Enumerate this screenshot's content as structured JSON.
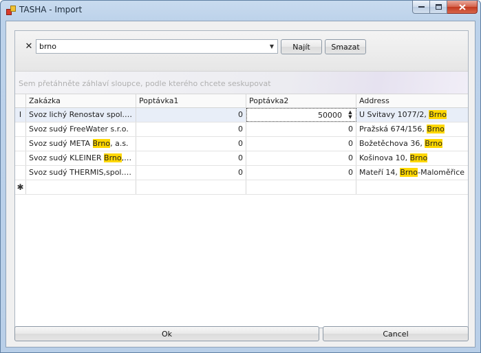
{
  "window": {
    "title": "TASHA - Import",
    "controls": {
      "minimize_icon": "minimize-icon",
      "maximize_icon": "maximize-icon",
      "close_icon": "close-icon"
    }
  },
  "search": {
    "clear_icon": "close-x-icon",
    "value": "brno",
    "find_label": "Najít",
    "clear_label": "Smazat"
  },
  "grouping": {
    "hint": "Sem přetáhněte záhlaví sloupce, podle kterého chcete seskupovat"
  },
  "grid": {
    "columns": [
      "Zakázka",
      "Poptávka1",
      "Poptávka2",
      "Address"
    ],
    "rows": [
      {
        "zakazka": [
          "Svoz lichý Renostav spol.s r.o."
        ],
        "poptavka1": "0",
        "poptavka2": "50000",
        "address": [
          "U Svitavy  1077/2, ",
          "Brno",
          ""
        ]
      },
      {
        "zakazka": [
          "Svoz sudý FreeWater s.r.o."
        ],
        "poptavka1": "0",
        "poptavka2": "0",
        "address": [
          "Pražská 674/156, ",
          "Brno",
          ""
        ]
      },
      {
        "zakazka": [
          "Svoz sudý META ",
          "Brno",
          ", a.s."
        ],
        "poptavka1": "0",
        "poptavka2": "0",
        "address": [
          "Božetěchova 36, ",
          "Brno",
          ""
        ]
      },
      {
        "zakazka": [
          "Svoz sudý KLEINER ",
          "Brno",
          ", sp..."
        ],
        "poptavka1": "0",
        "poptavka2": "0",
        "address": [
          "Košinova 10, ",
          "Brno",
          ""
        ]
      },
      {
        "zakazka": [
          "Svoz sudý THERMIS,spol.s r.o."
        ],
        "poptavka1": "0",
        "poptavka2": "0",
        "address": [
          "Mateří 14, ",
          "Brno",
          "-Maloměřice"
        ]
      }
    ],
    "current_row_indicator": "I",
    "new_row_indicator": "✱",
    "highlight_color": "#ffd700"
  },
  "footer": {
    "ok_label": "Ok",
    "cancel_label": "Cancel"
  }
}
